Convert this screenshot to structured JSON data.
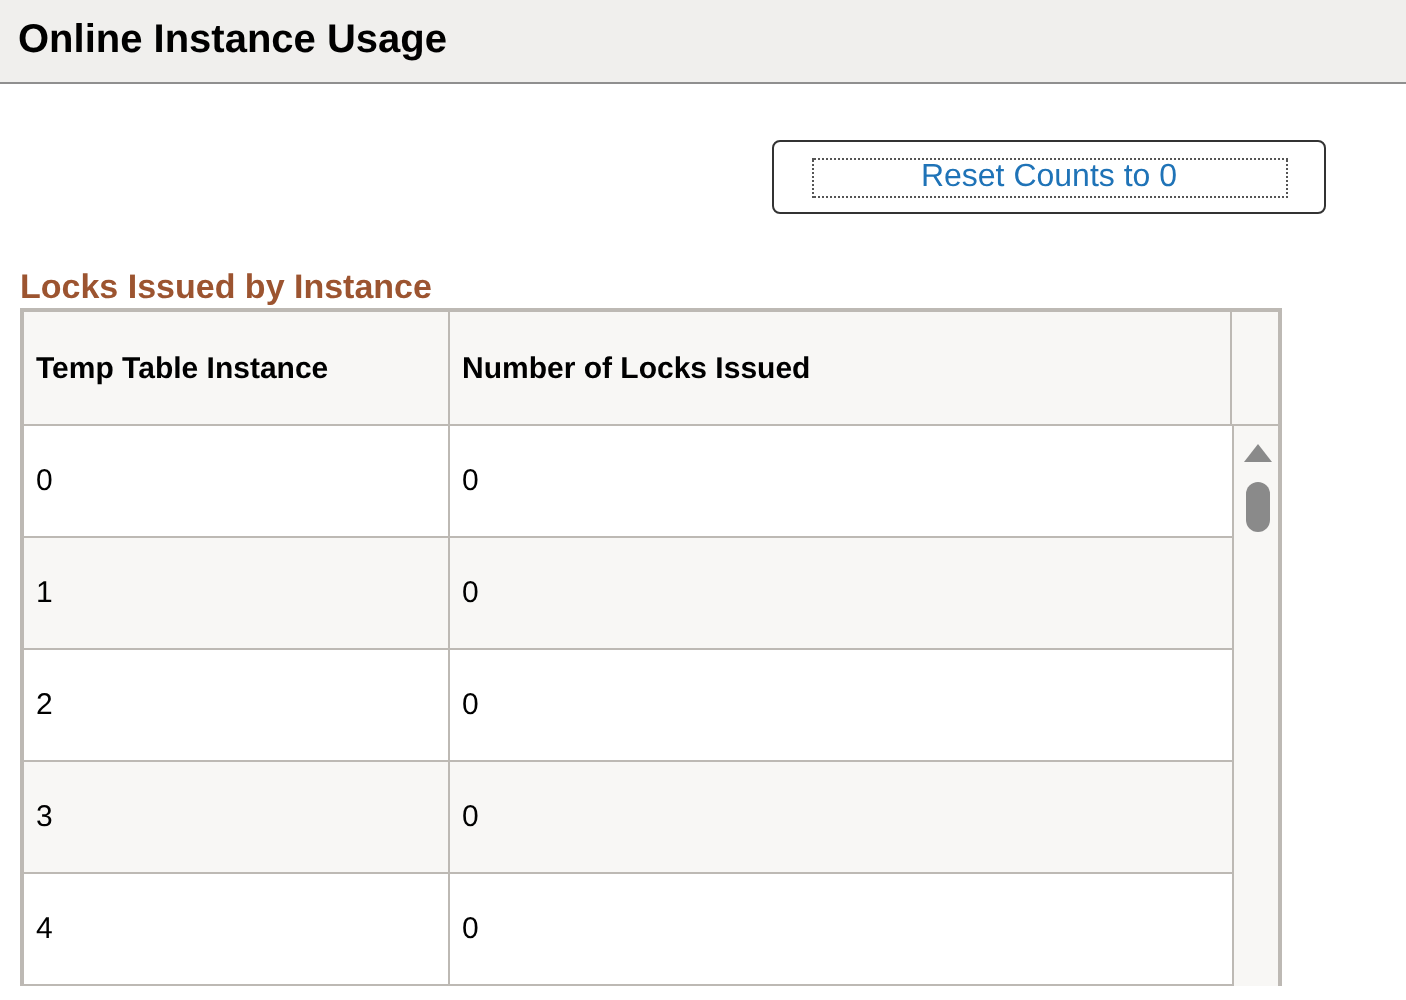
{
  "page": {
    "title": "Online Instance Usage"
  },
  "reset_button": {
    "label": "Reset Counts to 0"
  },
  "section": {
    "title": "Locks Issued by Instance"
  },
  "table": {
    "columns": [
      "Temp Table Instance",
      "Number of Locks Issued"
    ],
    "rows": [
      {
        "instance": "0",
        "locks": "0"
      },
      {
        "instance": "1",
        "locks": "0"
      },
      {
        "instance": "2",
        "locks": "0"
      },
      {
        "instance": "3",
        "locks": "0"
      },
      {
        "instance": "4",
        "locks": "0"
      }
    ]
  }
}
